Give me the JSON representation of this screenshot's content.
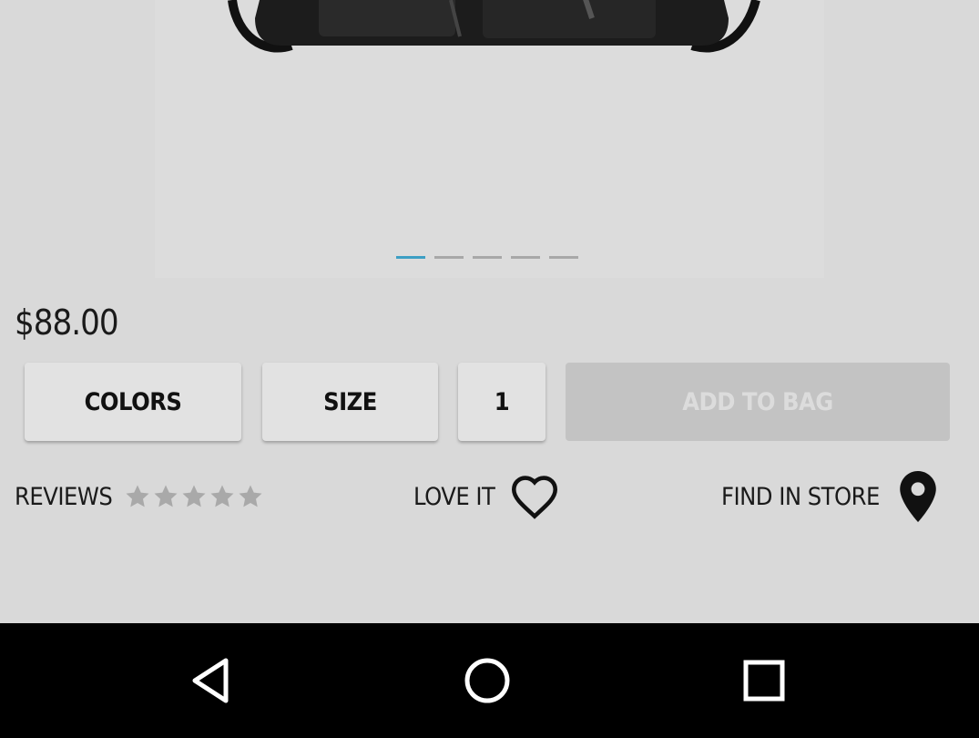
{
  "product": {
    "price": "$88.00",
    "image_pager": {
      "total": 5,
      "active_index": 0,
      "active_color": "#3d9fc4",
      "inactive_color": "#a8a8a8"
    }
  },
  "actions": {
    "colors_label": "COLORS",
    "size_label": "SIZE",
    "quantity": "1",
    "add_to_bag_label": "ADD TO BAG"
  },
  "links": {
    "reviews_label": "REVIEWS",
    "rating": {
      "value": 0,
      "max": 5
    },
    "love_it_label": "LOVE IT",
    "find_in_store_label": "FIND IN STORE"
  },
  "icons": {
    "love": "heart-outline-icon",
    "store": "map-pin-icon",
    "back": "back-triangle-icon",
    "home": "home-circle-icon",
    "recents": "recents-square-icon"
  }
}
